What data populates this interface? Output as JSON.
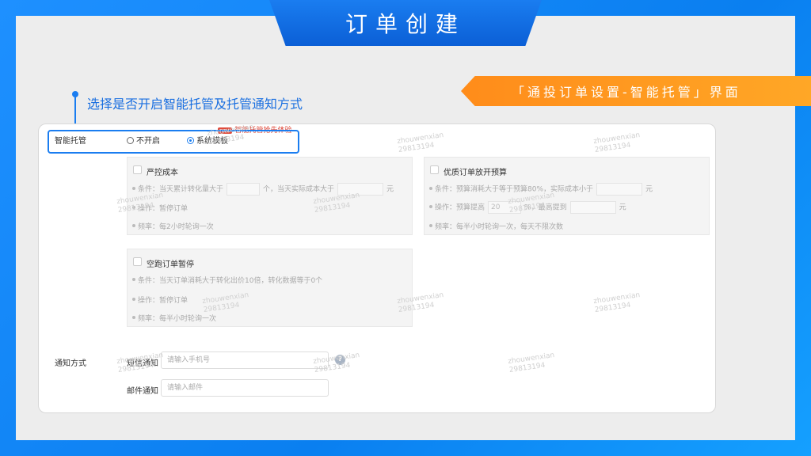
{
  "header": {
    "title": "订单创建"
  },
  "ribbon": {
    "text": "「通投订单设置-智能托管」界面"
  },
  "callout": {
    "text": "选择是否开启智能托管及托管通知方式"
  },
  "hosting": {
    "label": "智能托管",
    "options": [
      {
        "label": "不开启",
        "selected": false
      },
      {
        "label": "系统模板",
        "selected": true
      }
    ],
    "hot_tag": "new",
    "hot_text": "智能托管抢先体验"
  },
  "cards": {
    "strict_cost": {
      "title": "严控成本",
      "cond_prefix": "条件：当天累计转化量大于",
      "cond_unit1": "个",
      "cond_mid": "，当天实际成本大于",
      "cond_unit2": "元",
      "action": "操作：暂停订单",
      "freq": "频率：每2小时轮询一次"
    },
    "quality_budget": {
      "title": "优质订单放开预算",
      "cond_prefix": "条件：预算消耗大于等于预算80%，实际成本小于",
      "cond_unit": "元",
      "action_prefix": "操作：预算提高",
      "action_value": "20",
      "action_mid": "%，最高提到",
      "action_unit": "元",
      "freq": "频率：每半小时轮询一次，每天不限次数"
    },
    "empty_run": {
      "title": "空跑订单暂停",
      "cond": "条件：当天订单消耗大于转化出价10倍，转化数据等于0个",
      "action": "操作：暂停订单",
      "freq": "频率：每半小时轮询一次"
    }
  },
  "notify": {
    "label": "通知方式",
    "sms_label": "短信通知",
    "sms_placeholder": "请输入手机号",
    "email_label": "邮件通知",
    "email_placeholder": "请输入邮件",
    "help_glyph": "?"
  },
  "watermark": {
    "line1": "zhouwenxian",
    "line2": "29813194"
  },
  "colors": {
    "accent": "#1a7df0",
    "ribbon": "#ff8c1a",
    "hot": "#e04a3a"
  }
}
